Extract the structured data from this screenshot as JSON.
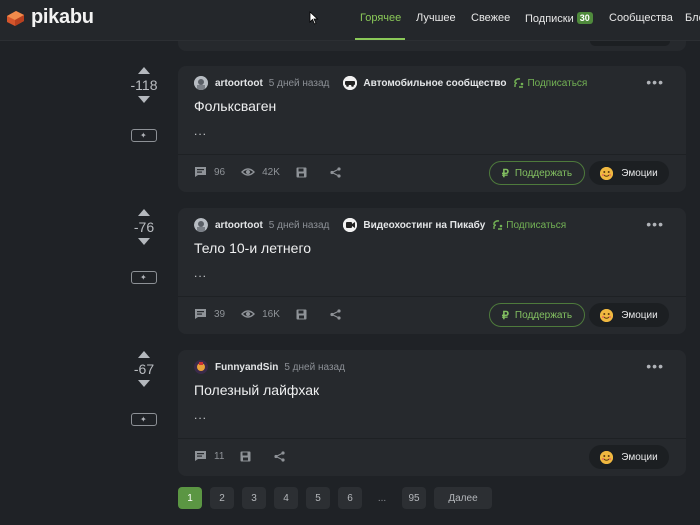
{
  "header": {
    "logo_text": "pikabu",
    "nav": [
      {
        "label": "Горячее",
        "active": true
      },
      {
        "label": "Лучшее",
        "active": false
      },
      {
        "label": "Свежее",
        "active": false
      },
      {
        "label": "Подписки",
        "badge": "30",
        "active": false
      },
      {
        "label": "Сообщества",
        "active": false
      },
      {
        "label": "Бло",
        "active": false
      }
    ]
  },
  "posts": [
    {
      "score": "-118",
      "author": "artoortoot",
      "time": "5 дней назад",
      "community": "Автомобильное сообщество",
      "subscribe": "Подписаться",
      "title": "Фольксваген",
      "excerpt": "...",
      "comments": "96",
      "views": "42K",
      "support": "Поддержать",
      "emotions": "Эмоции"
    },
    {
      "score": "-76",
      "author": "artoortoot",
      "time": "5 дней назад",
      "community": "Видеохостинг на Пикабу",
      "subscribe": "Подписаться",
      "title": "Тело 10-и летнего",
      "excerpt": "...",
      "comments": "39",
      "views": "16K",
      "support": "Поддержать",
      "emotions": "Эмоции"
    },
    {
      "score": "-67",
      "author": "FunnyandSin",
      "time": "5 дней назад",
      "title": "Полезный лайфхак",
      "excerpt": "...",
      "comments": "11",
      "emotions": "Эмоции"
    }
  ],
  "pagination": {
    "pages": [
      "1",
      "2",
      "3",
      "4",
      "5",
      "6"
    ],
    "gap": "...",
    "last": "95",
    "next": "Далее",
    "current": "1"
  },
  "colors": {
    "accent": "#8ac858",
    "background": "#1f2226",
    "card": "#26292d"
  }
}
